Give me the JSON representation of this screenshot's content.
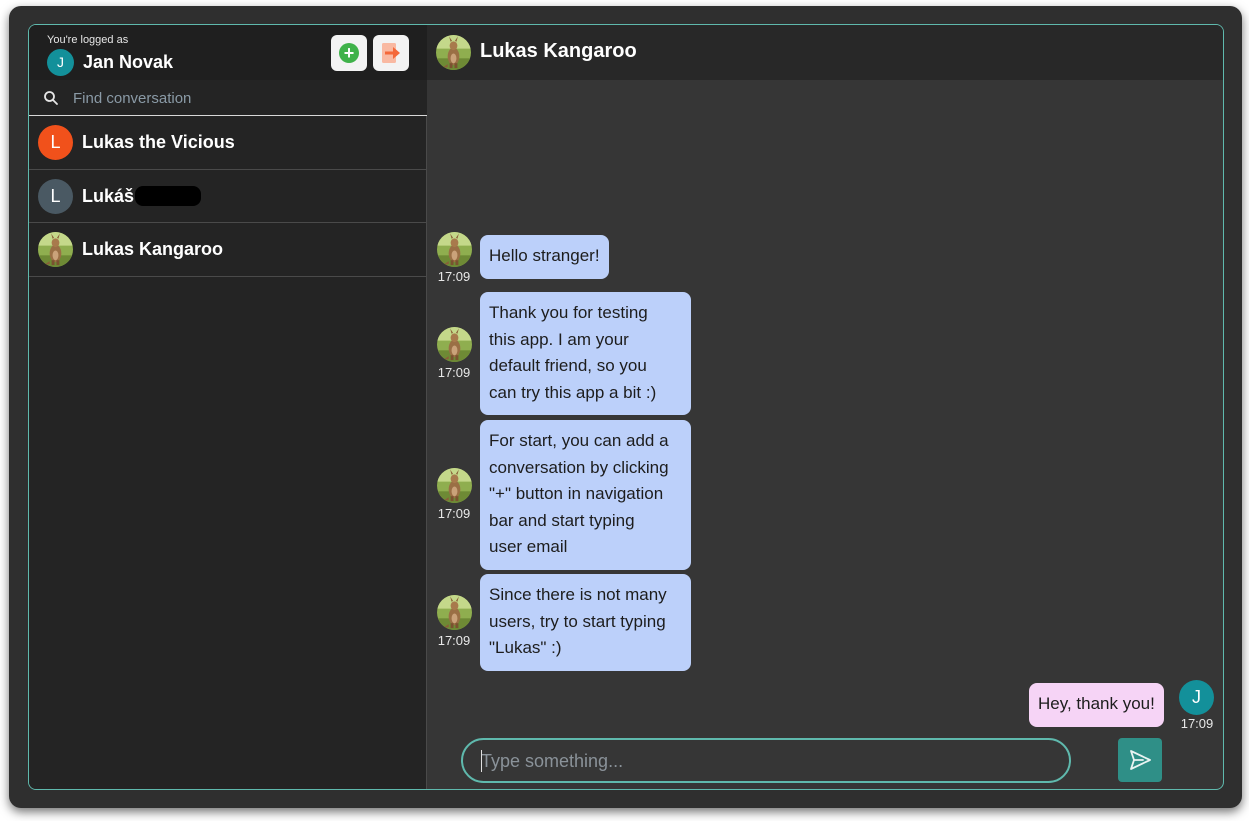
{
  "sidebar": {
    "logged_as_label": "You're logged as",
    "user_initial": "J",
    "user_name": "Jan Novak",
    "add_button_icon": "plus-circle-icon",
    "logout_button_icon": "logout-icon",
    "search_placeholder": "Find conversation",
    "conversations": [
      {
        "initial": "L",
        "name": "Lukas the Vicious",
        "avatar_color": "#f1511b",
        "avatar_type": "initial"
      },
      {
        "initial": "L",
        "name": "Lukáš ",
        "avatar_color": "#4a5963",
        "avatar_type": "initial",
        "redacted": true
      },
      {
        "name": "Lukas Kangaroo",
        "avatar_type": "kangaroo-photo"
      }
    ]
  },
  "chat": {
    "title": "Lukas Kangaroo",
    "messages": [
      {
        "from": "Lukas Kangaroo",
        "time": "17:09",
        "lines": [
          "Hello stranger!"
        ]
      },
      {
        "from": "Lukas Kangaroo",
        "time": "17:09",
        "lines": [
          "Thank you for testing",
          "this app. I am your",
          "default friend, so you",
          "can try this app a bit :)"
        ]
      },
      {
        "from": "Lukas Kangaroo",
        "time": "17:09",
        "lines": [
          "For start, you can add a",
          "conversation by clicking",
          "\"+\" button in navigation",
          "bar and start typing",
          "user email"
        ]
      },
      {
        "from": "Lukas Kangaroo",
        "time": "17:09",
        "lines": [
          "Since there is not many",
          "users, try to start typing",
          "\"Lukas\" :)"
        ]
      },
      {
        "from": "me",
        "initial": "J",
        "time": "17:09",
        "lines": [
          "Hey, thank you!"
        ]
      }
    ],
    "composer_placeholder": "Type something...",
    "send_icon": "send-icon"
  },
  "colors": {
    "accent": "#5fb9ad",
    "incoming_bubble": "#bcd0fa",
    "outgoing_bubble": "#f6d4f6",
    "user_avatar": "#13909a",
    "add_green": "#3fb24a",
    "logout_orange": "#f4683a"
  }
}
